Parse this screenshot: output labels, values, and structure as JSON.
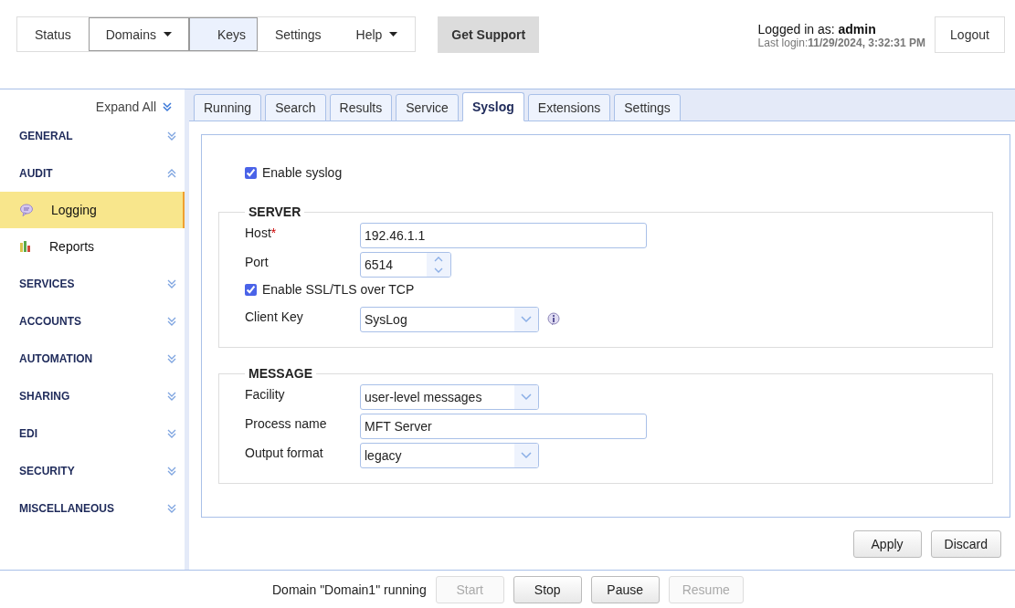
{
  "top_nav": [
    {
      "label": "Status",
      "has_menu": false,
      "selected": false,
      "focused": false
    },
    {
      "label": "Domains",
      "has_menu": true,
      "selected": false,
      "focused": true
    },
    {
      "label": "Keys",
      "has_menu": false,
      "selected": true,
      "focused": false
    },
    {
      "label": "Settings",
      "has_menu": false,
      "selected": false,
      "focused": false
    },
    {
      "label": "Help",
      "has_menu": true,
      "selected": false,
      "focused": false
    }
  ],
  "support_button": "Get Support",
  "user": {
    "prefix": "Logged in as: ",
    "name": "admin",
    "last_login_label": "Last login:",
    "last_login": "11/29/2024, 3:32:31 PM"
  },
  "logout_button": "Logout",
  "sidebar": {
    "expand_all": "Expand All",
    "sections": [
      {
        "label": "GENERAL",
        "expanded": false
      },
      {
        "label": "AUDIT",
        "expanded": true,
        "children": [
          {
            "label": "Logging",
            "selected": true
          },
          {
            "label": "Reports",
            "selected": false
          }
        ]
      },
      {
        "label": "SERVICES",
        "expanded": false
      },
      {
        "label": "ACCOUNTS",
        "expanded": false
      },
      {
        "label": "AUTOMATION",
        "expanded": false
      },
      {
        "label": "SHARING",
        "expanded": false
      },
      {
        "label": "EDI",
        "expanded": false
      },
      {
        "label": "SECURITY",
        "expanded": false
      },
      {
        "label": "MISCELLANEOUS",
        "expanded": false
      }
    ]
  },
  "tabs": [
    {
      "label": "Running",
      "selected": false
    },
    {
      "label": "Search",
      "selected": false
    },
    {
      "label": "Results",
      "selected": false
    },
    {
      "label": "Service",
      "selected": false
    },
    {
      "label": "Syslog",
      "selected": true
    },
    {
      "label": "Extensions",
      "selected": false
    },
    {
      "label": "Settings",
      "selected": false
    }
  ],
  "enable_syslog": {
    "label": "Enable syslog",
    "checked": true
  },
  "groups": [
    {
      "title": "SERVER",
      "fields": [
        {
          "kind": "text",
          "label": "Host",
          "required_mark": "*",
          "value": "192.46.1.1"
        },
        {
          "kind": "number",
          "label": "Port",
          "value": "6514"
        },
        {
          "kind": "checkbox",
          "label": "Enable SSL/TLS over TCP",
          "checked": true
        },
        {
          "kind": "select",
          "label": "Client Key",
          "value": "SysLog",
          "has_info": true
        }
      ]
    },
    {
      "title": "MESSAGE",
      "fields": [
        {
          "kind": "select",
          "label": "Facility",
          "value": "user-level messages",
          "has_info": false
        },
        {
          "kind": "text",
          "label": "Process name",
          "value": "MFT Server"
        },
        {
          "kind": "select",
          "label": "Output format",
          "value": "legacy",
          "has_info": false
        }
      ]
    }
  ],
  "actions": [
    {
      "label": "Apply"
    },
    {
      "label": "Discard"
    }
  ],
  "footer": {
    "status": "Domain \"Domain1\" running",
    "buttons": [
      {
        "label": "Start",
        "disabled": true
      },
      {
        "label": "Stop",
        "disabled": false
      },
      {
        "label": "Pause",
        "disabled": false
      },
      {
        "label": "Resume",
        "disabled": true
      }
    ]
  }
}
